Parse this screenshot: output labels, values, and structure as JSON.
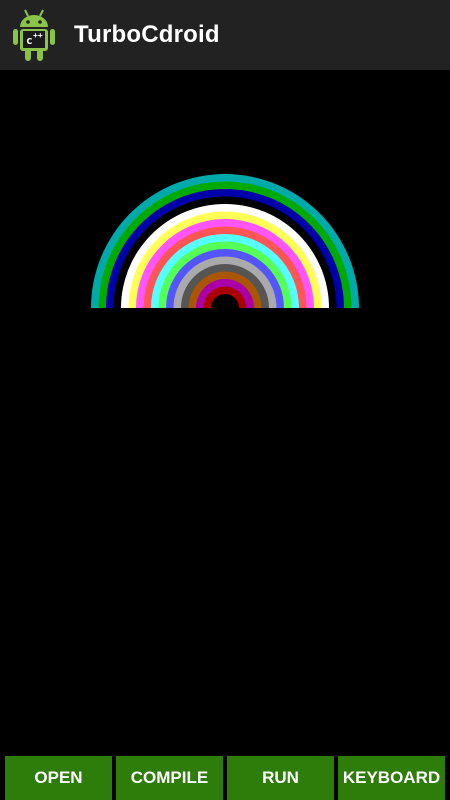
{
  "app": {
    "title": "TurboCdroid",
    "icon": "android-robot-icon"
  },
  "canvas": {
    "graphic": "rainbow-arcs",
    "arc_colors": [
      "#00aaaa",
      "#00aa00",
      "#0000aa",
      "#000000",
      "#ffffff",
      "#ffff55",
      "#ff55ff",
      "#ff5555",
      "#55ffff",
      "#55ff55",
      "#5555ff",
      "#aaaaaa",
      "#555555",
      "#aa5500",
      "#aa00aa",
      "#aa0000"
    ]
  },
  "toolbar": {
    "open_label": "OPEN",
    "compile_label": "COMPILE",
    "run_label": "RUN",
    "keyboard_label": "KEYBOARD"
  },
  "colors": {
    "titlebar_bg": "#222222",
    "button_bg": "#2e7d0a",
    "android_green": "#8bc34a"
  }
}
